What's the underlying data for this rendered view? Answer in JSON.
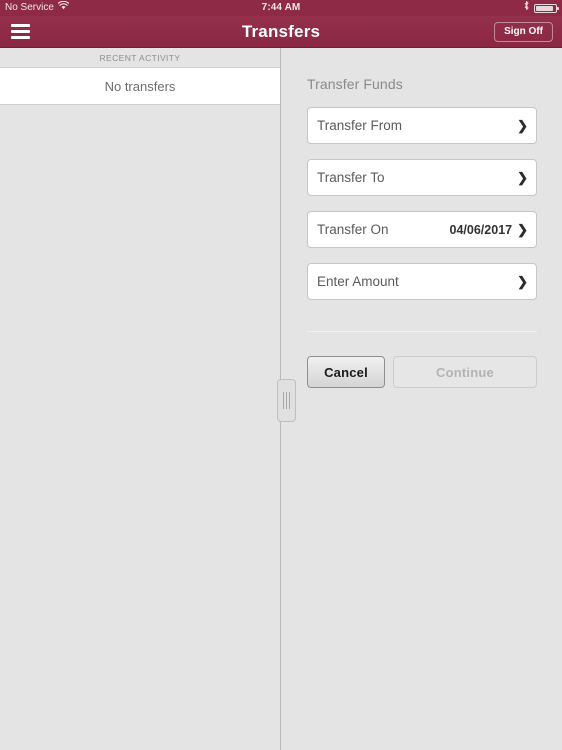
{
  "status_bar": {
    "carrier": "No Service",
    "wifi_icon": "wifi-icon",
    "time": "7:44 AM",
    "bluetooth_icon": "bluetooth-icon",
    "battery_icon": "battery-icon"
  },
  "nav_bar": {
    "menu_icon": "hamburger-menu-icon",
    "title": "Transfers",
    "sign_off_label": "Sign Off",
    "background_color": "#8e2a46"
  },
  "left_pane": {
    "section_header": "RECENT ACTIVITY",
    "empty_message": "No transfers"
  },
  "split_handle": {
    "grip_icon": "split-view-grip-icon"
  },
  "right_pane": {
    "form_title": "Transfer Funds",
    "fields": [
      {
        "label": "Transfer From",
        "value": "",
        "chevron": "❯"
      },
      {
        "label": "Transfer To",
        "value": "",
        "chevron": "❯"
      },
      {
        "label": "Transfer On",
        "value": "04/06/2017",
        "chevron": "❯"
      },
      {
        "label": "Enter Amount",
        "value": "",
        "chevron": "❯"
      }
    ],
    "buttons": {
      "cancel_label": "Cancel",
      "continue_label": "Continue"
    }
  }
}
